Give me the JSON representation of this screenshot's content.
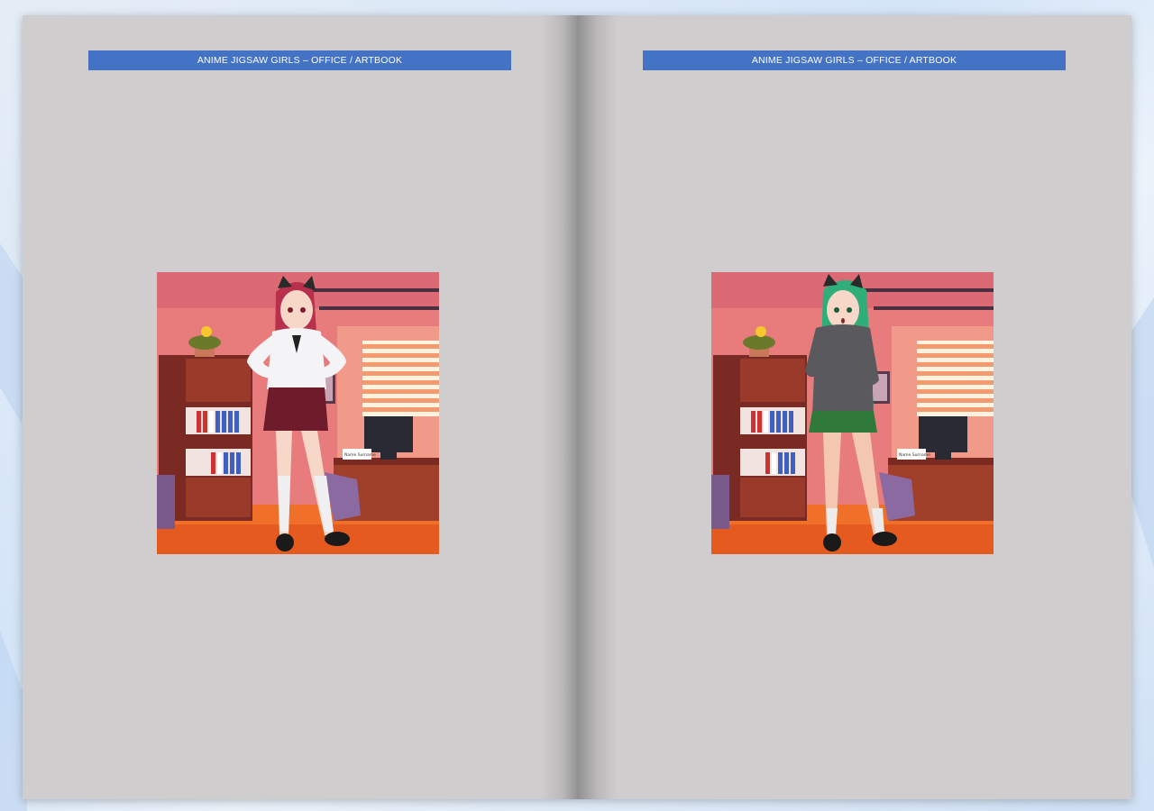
{
  "pages": [
    {
      "header": "ANIME JIGSAW GIRLS – OFFICE / ARTBOOK",
      "artwork": {
        "nameplate": "Name Surname",
        "hair_color": "#b8304c",
        "top_color": "#f4f4f6",
        "skirt_color": "#6e1c2c",
        "outfit": "white-blouse-ribbon"
      }
    },
    {
      "header": "ANIME JIGSAW GIRLS – OFFICE / ARTBOOK",
      "artwork": {
        "nameplate": "Name Surname",
        "hair_color": "#2fae7a",
        "top_color": "#5a5a5e",
        "skirt_color": "#2f7a3a",
        "outfit": "grey-sweater"
      }
    }
  ]
}
